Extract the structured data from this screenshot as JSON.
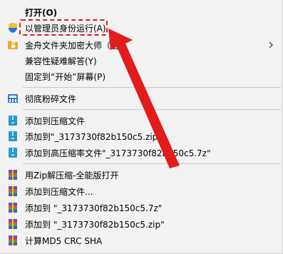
{
  "menu": {
    "items": [
      {
        "label": "打开(O)",
        "bold": true
      },
      {
        "label": "以管理员身份运行(A)"
      },
      {
        "label": "金舟文件夹加密大师（官"
      },
      {
        "label": "兼容性疑难解答(Y)"
      },
      {
        "label": "固定到“开始”屏幕(P)"
      },
      {
        "label": "彻底粉碎文件"
      },
      {
        "label": "添加到压缩文件"
      },
      {
        "label": "添加到\"_3173730f82b150c5.zip\""
      },
      {
        "label": "添加到高压缩率文件\"_3173730f82b150c5.7z\""
      },
      {
        "label": "用Zip解压缩-全能版打开"
      },
      {
        "label": "添加到压缩文件..."
      },
      {
        "label": "添加到 \"_3173730f82b150c5.7z\""
      },
      {
        "label": "添加到 \"_3173730f82b150c5.zip\""
      },
      {
        "label": "计算MD5 CRC SHA"
      }
    ]
  },
  "colors": {
    "annotation": "#e21b1b",
    "background": "#f2f2f2"
  }
}
